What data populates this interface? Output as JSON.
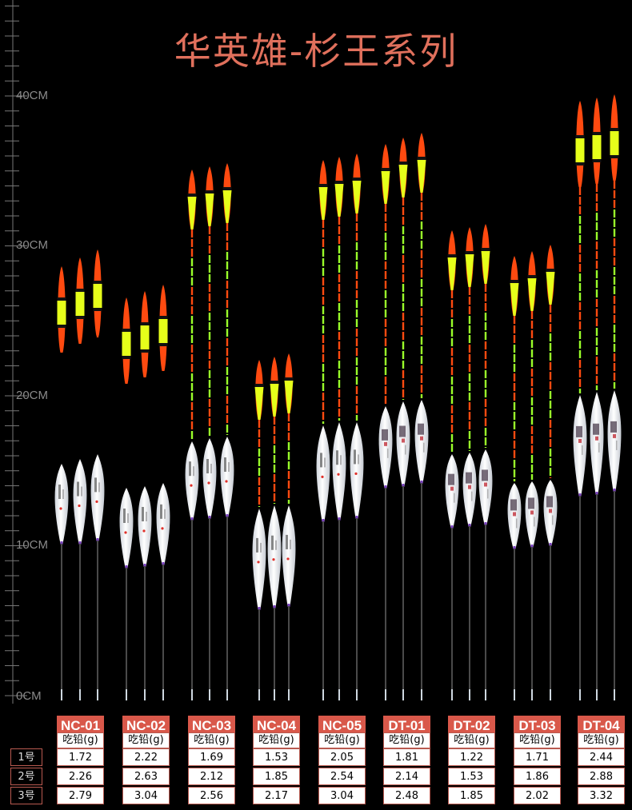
{
  "title": "华英雄-杉王系列",
  "ruler": {
    "labels": [
      "40CM",
      "30CM",
      "20CM",
      "10CM",
      "0CM"
    ]
  },
  "table": {
    "header": "吃铅(g)",
    "rows": [
      "1号",
      "2号",
      "3号"
    ],
    "models": [
      {
        "name": "NC-01",
        "values": [
          "1.72",
          "2.26",
          "2.79"
        ]
      },
      {
        "name": "NC-02",
        "values": [
          "2.22",
          "2.63",
          "3.04"
        ]
      },
      {
        "name": "NC-03",
        "values": [
          "1.69",
          "2.12",
          "2.56"
        ]
      },
      {
        "name": "NC-04",
        "values": [
          "1.53",
          "1.85",
          "2.17"
        ]
      },
      {
        "name": "NC-05",
        "values": [
          "2.05",
          "2.54",
          "3.04"
        ]
      },
      {
        "name": "DT-01",
        "values": [
          "1.81",
          "2.14",
          "2.48"
        ]
      },
      {
        "name": "DT-02",
        "values": [
          "1.22",
          "1.53",
          "1.85"
        ]
      },
      {
        "name": "DT-03",
        "values": [
          "1.71",
          "1.86",
          "2.02"
        ]
      },
      {
        "name": "DT-04",
        "values": [
          "2.44",
          "2.88",
          "3.32"
        ]
      }
    ]
  },
  "colors": {
    "accent": "#d9584a",
    "title": "#e0705c",
    "tip_orange": "#ff4a10",
    "tip_yellow": "#e6ff1a"
  }
}
